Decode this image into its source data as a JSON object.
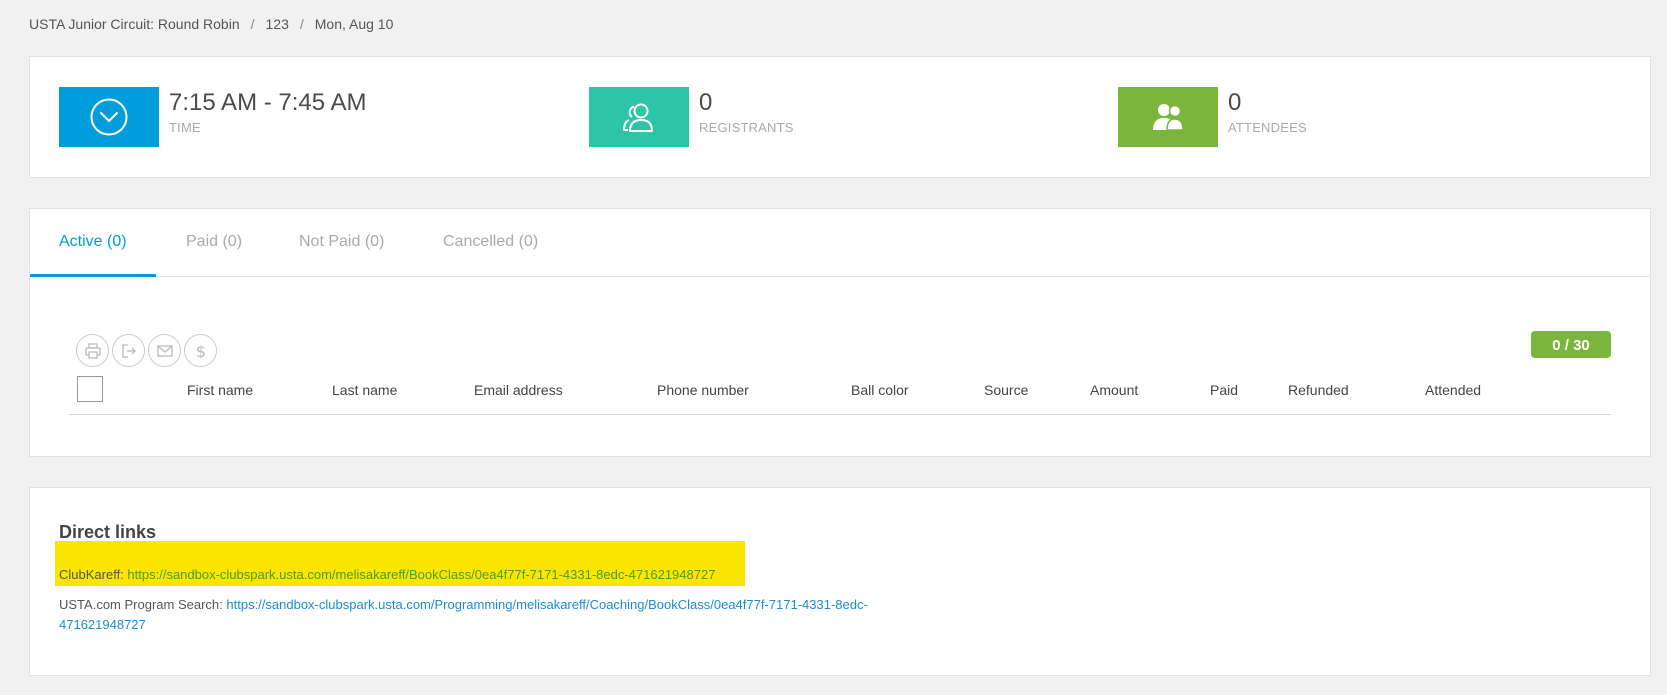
{
  "breadcrumb": {
    "program": "USTA Junior Circuit: Round Robin",
    "session": "123",
    "date": "Mon, Aug 10"
  },
  "stats": {
    "time": {
      "value": "7:15 AM - 7:45 AM",
      "label": "TIME",
      "color": "#009ddc"
    },
    "registrants": {
      "value": "0",
      "label": "REGISTRANTS",
      "color": "#2cc5a5"
    },
    "attendees": {
      "value": "0",
      "label": "ATTENDEES",
      "color": "#7ab63c"
    }
  },
  "tabs": [
    {
      "label": "Active (0)",
      "active": true
    },
    {
      "label": "Paid (0)"
    },
    {
      "label": "Not Paid (0)"
    },
    {
      "label": "Cancelled (0)"
    }
  ],
  "toolbar": {
    "icons": [
      "print-icon",
      "export-icon",
      "email-icon",
      "dollar-icon"
    ]
  },
  "capacity": "0 / 30",
  "table": {
    "columns": [
      "First name",
      "Last name",
      "Email address",
      "Phone number",
      "Ball color",
      "Source",
      "Amount",
      "Paid",
      "Refunded",
      "Attended"
    ]
  },
  "direct_links": {
    "title": "Direct links",
    "items": [
      {
        "label": "ClubKareff:",
        "url": "https://sandbox-clubspark.usta.com/melisakareff/BookClass/0ea4f77f-7171-4331-8edc-471621948727"
      },
      {
        "label": "USTA.com Program Search:",
        "url": "https://sandbox-clubspark.usta.com/Programming/melisakareff/Coaching/BookClass/0ea4f77f-7171-4331-8edc-471621948727"
      }
    ]
  }
}
